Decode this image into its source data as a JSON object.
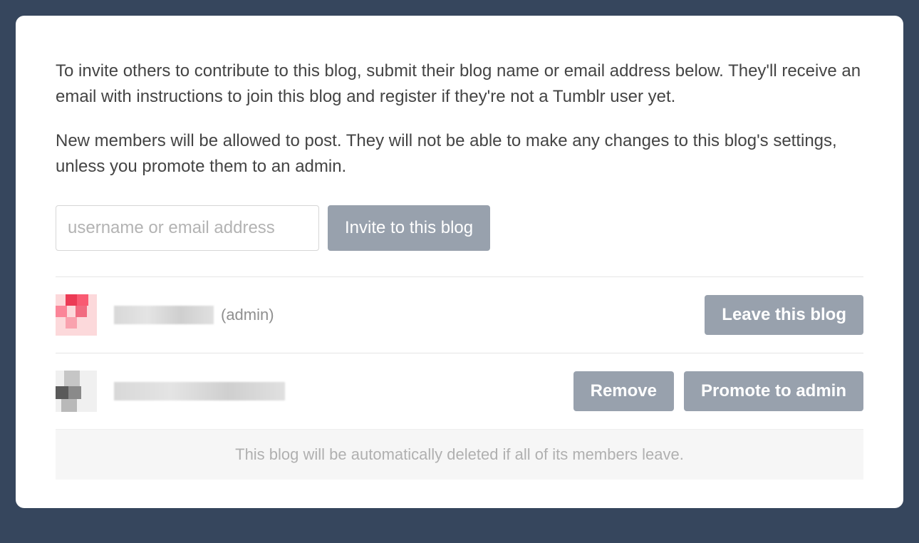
{
  "intro": {
    "paragraph1": "To invite others to contribute to this blog, submit their blog name or email address below. They'll receive an email with instructions to join this blog and register if they're not a Tumblr user yet.",
    "paragraph2": "New members will be allowed to post. They will not be able to make any changes to this blog's settings, unless you promote them to an admin."
  },
  "invite": {
    "placeholder": "username or email address",
    "button_label": "Invite to this blog"
  },
  "members": [
    {
      "role_label": "(admin)",
      "actions": {
        "leave_label": "Leave this blog"
      }
    },
    {
      "actions": {
        "remove_label": "Remove",
        "promote_label": "Promote to admin"
      }
    }
  ],
  "footer": {
    "note": "This blog will be automatically deleted if all of its members leave."
  }
}
